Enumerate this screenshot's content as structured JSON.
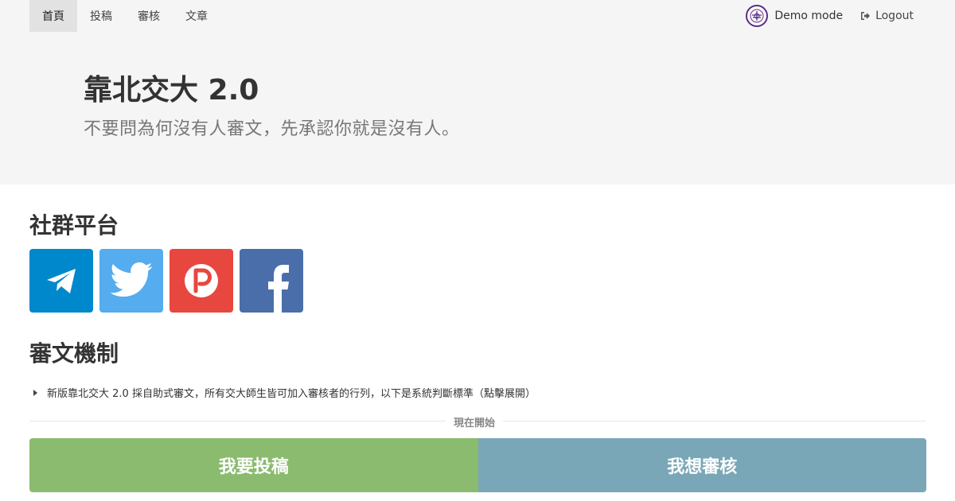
{
  "nav": {
    "items": [
      {
        "label": "首頁",
        "active": true
      },
      {
        "label": "投稿",
        "active": false
      },
      {
        "label": "審核",
        "active": false
      },
      {
        "label": "文章",
        "active": false
      }
    ],
    "user_label": "Demo mode",
    "logout_label": "Logout"
  },
  "hero": {
    "title": "靠北交大 2.0",
    "subtitle": "不要問為何沒有人審文，先承認你就是沒有人。"
  },
  "social": {
    "heading": "社群平台",
    "platforms": [
      {
        "name": "telegram",
        "icon": "telegram-icon",
        "color": "#0088cc"
      },
      {
        "name": "twitter",
        "icon": "twitter-icon",
        "color": "#55acee"
      },
      {
        "name": "plurk",
        "icon": "plurk-icon",
        "color": "#e8473f"
      },
      {
        "name": "facebook",
        "icon": "facebook-icon",
        "color": "#4a6ea9"
      }
    ]
  },
  "mechanism": {
    "heading": "審文機制",
    "summary": "新版靠北交大 2.0 採自助式審文，所有交大師生皆可加入審核者的行列，以下是系統判斷標準（點擊展開）"
  },
  "divider_label": "現在開始",
  "actions": {
    "submit_label": "我要投稿",
    "review_label": "我想審核",
    "submit_color": "#8bbb6f",
    "review_color": "#7aa7b8"
  }
}
